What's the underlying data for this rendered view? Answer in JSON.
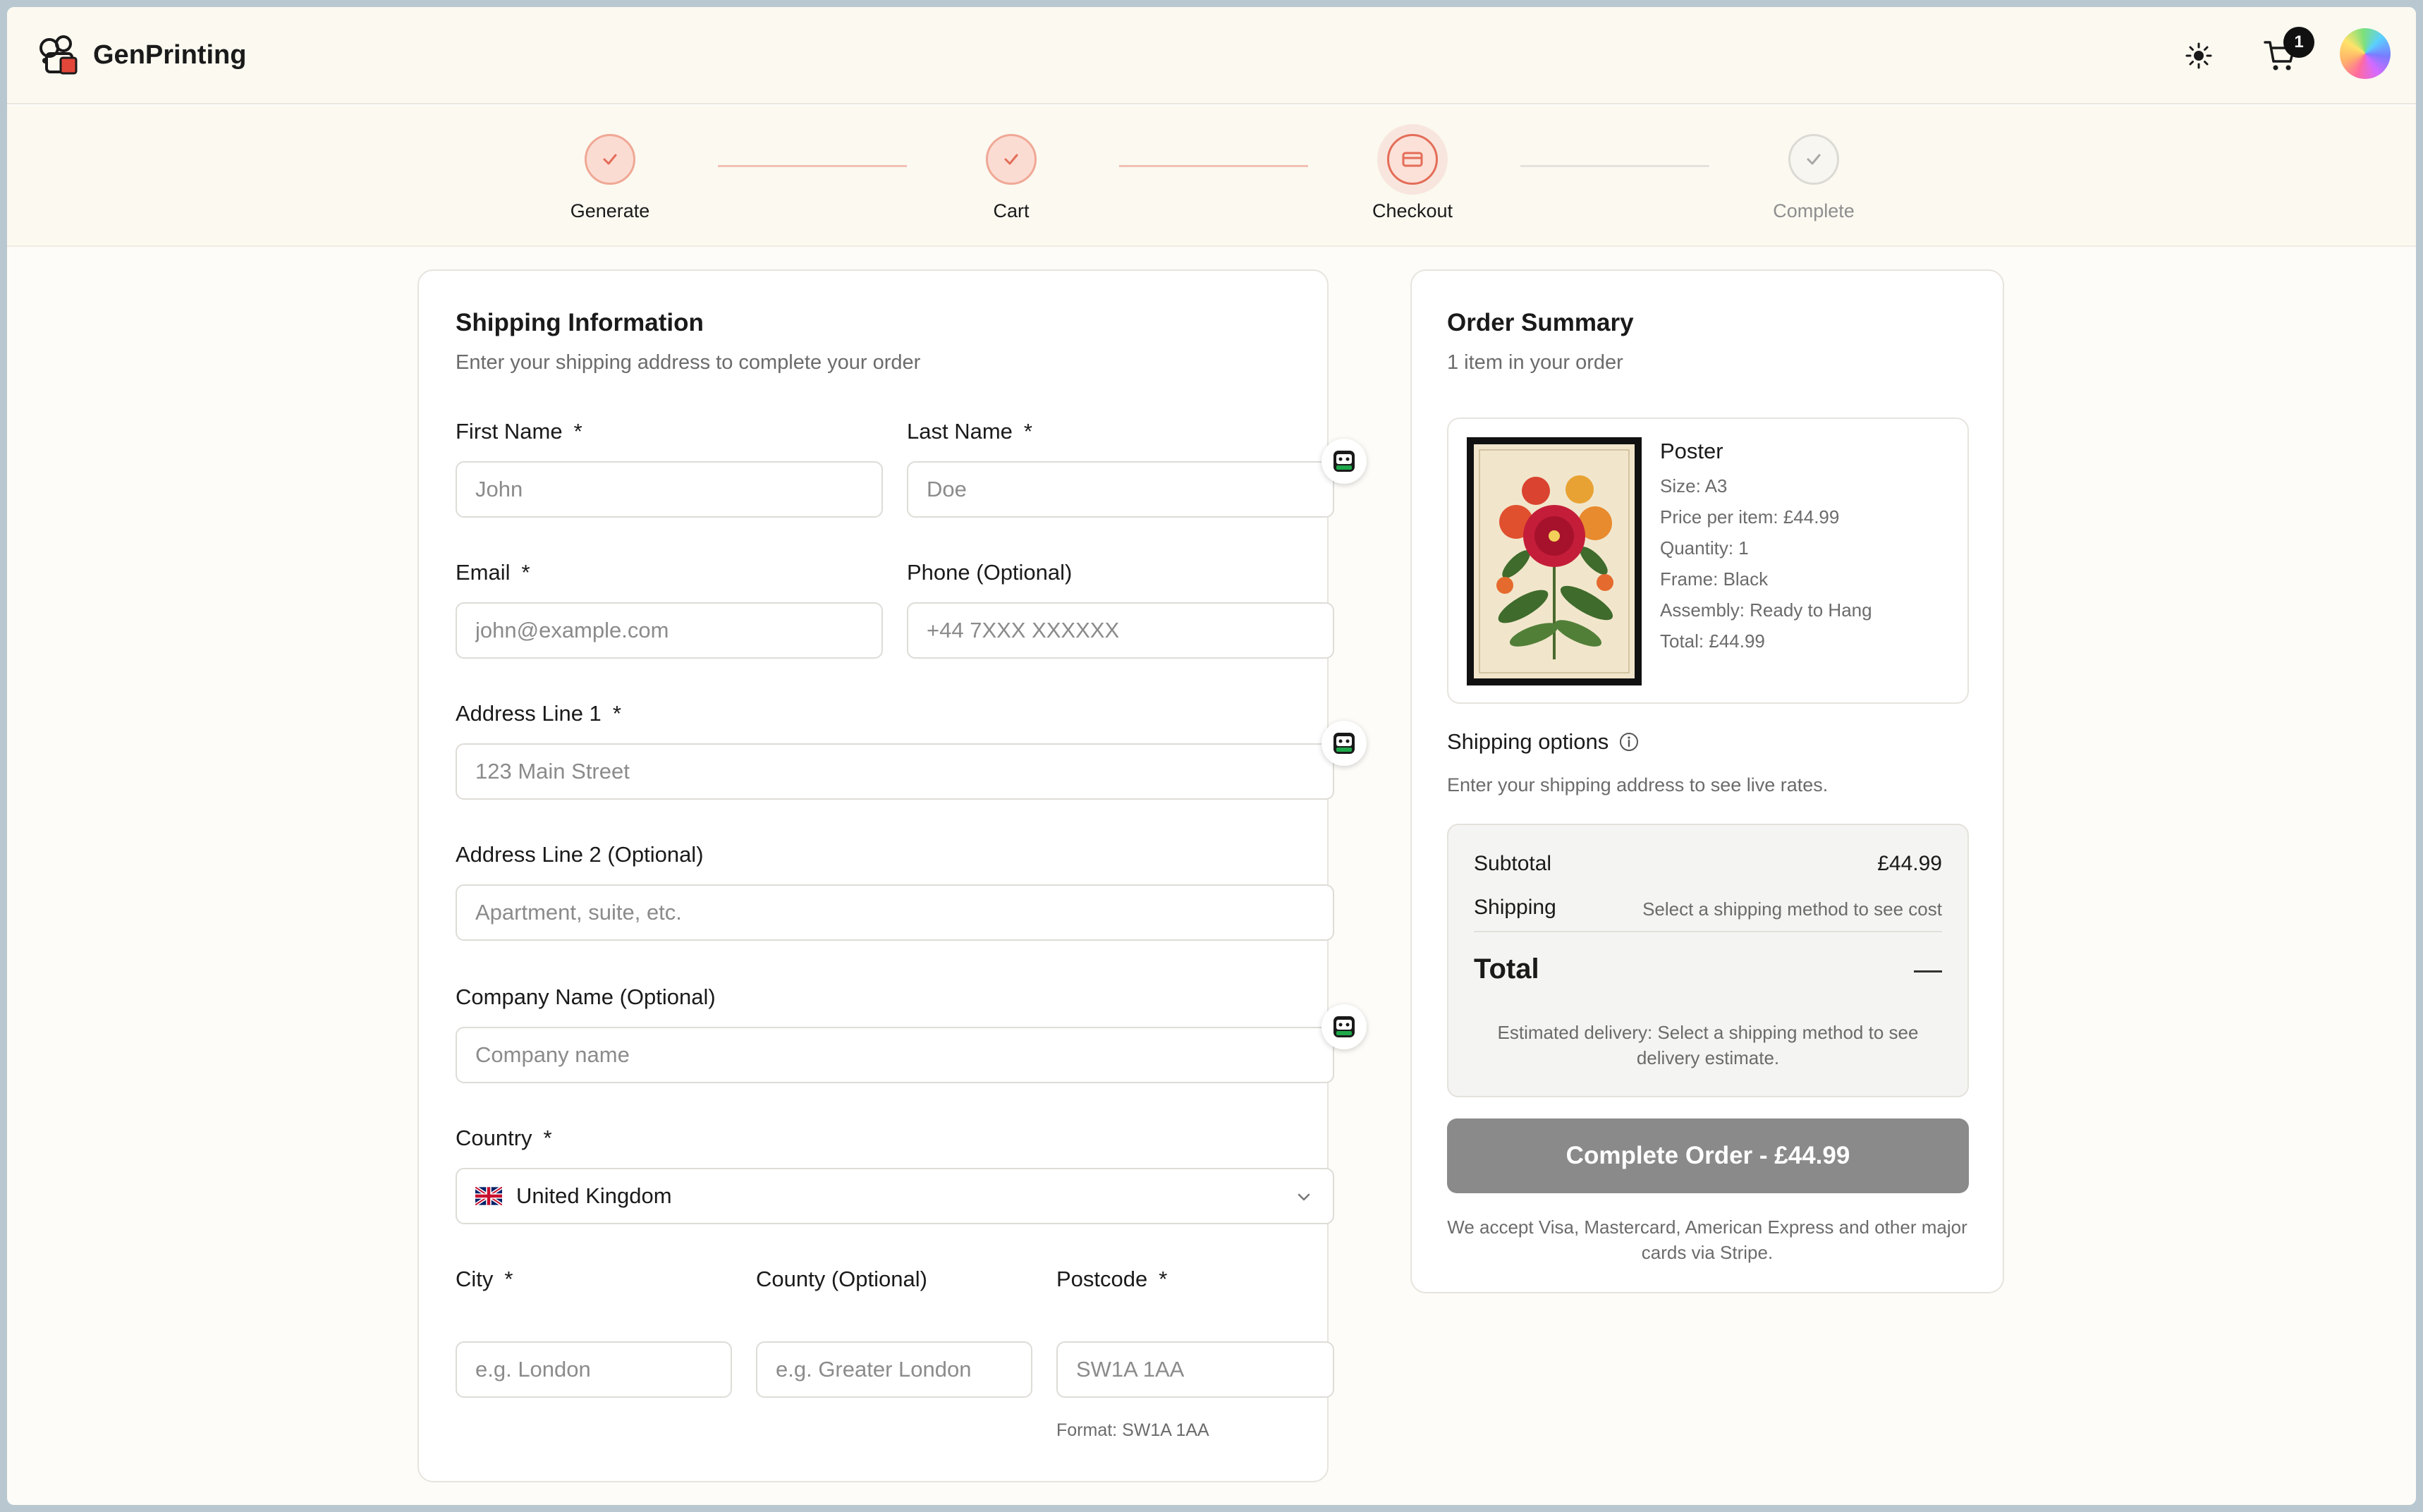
{
  "header": {
    "brand": "GenPrinting",
    "cart_count": "1"
  },
  "stepper": {
    "steps": [
      {
        "label": "Generate",
        "state": "done"
      },
      {
        "label": "Cart",
        "state": "done"
      },
      {
        "label": "Checkout",
        "state": "active"
      },
      {
        "label": "Complete",
        "state": "pending"
      }
    ]
  },
  "shipping": {
    "title": "Shipping Information",
    "subtitle": "Enter your shipping address to complete your order",
    "required_mark": "*",
    "first_name": {
      "label": "First Name",
      "placeholder": "John"
    },
    "last_name": {
      "label": "Last Name",
      "placeholder": "Doe"
    },
    "email": {
      "label": "Email",
      "placeholder": "john@example.com"
    },
    "phone": {
      "label": "Phone (Optional)",
      "placeholder": "+44 7XXX XXXXXX"
    },
    "address1": {
      "label": "Address Line 1",
      "placeholder": "123 Main Street"
    },
    "address2": {
      "label": "Address Line 2 (Optional)",
      "placeholder": "Apartment, suite, etc."
    },
    "company": {
      "label": "Company Name (Optional)",
      "placeholder": "Company name"
    },
    "country": {
      "label": "Country",
      "value": "United Kingdom"
    },
    "city": {
      "label": "City",
      "placeholder": "e.g. London"
    },
    "county": {
      "label": "County (Optional)",
      "placeholder": "e.g. Greater London"
    },
    "postcode": {
      "label": "Postcode",
      "placeholder": "SW1A 1AA",
      "helper": "Format: SW1A 1AA"
    }
  },
  "summary": {
    "title": "Order Summary",
    "subtitle": "1 item in your order",
    "item": {
      "name": "Poster",
      "lines": [
        "Size: A3",
        "Price per item: £44.99",
        "Quantity: 1",
        "Frame: Black",
        "Assembly: Ready to Hang",
        "Total: £44.99"
      ]
    },
    "shipping_options_title": "Shipping options",
    "shipping_options_sub": "Enter your shipping address to see live rates.",
    "subtotal_label": "Subtotal",
    "subtotal_value": "£44.99",
    "shipping_label": "Shipping",
    "shipping_value": "Select a shipping method to see cost",
    "total_label": "Total",
    "estimate": "Estimated delivery: Select a shipping method to see delivery estimate.",
    "button": "Complete Order - £44.99",
    "accept": "We accept Visa, Mastercard, American Express and other major cards via Stripe."
  },
  "colors": {
    "accent": "#e46d58",
    "accent_soft": "#fbdcd3",
    "button_disabled": "#8a8a8a",
    "autofill_green": "#1ea84a"
  },
  "icons": {
    "theme": "sun-icon",
    "cart": "cart-icon",
    "autofill": "password-manager-icon",
    "info": "info-icon",
    "select": "chevron-down-icon"
  }
}
